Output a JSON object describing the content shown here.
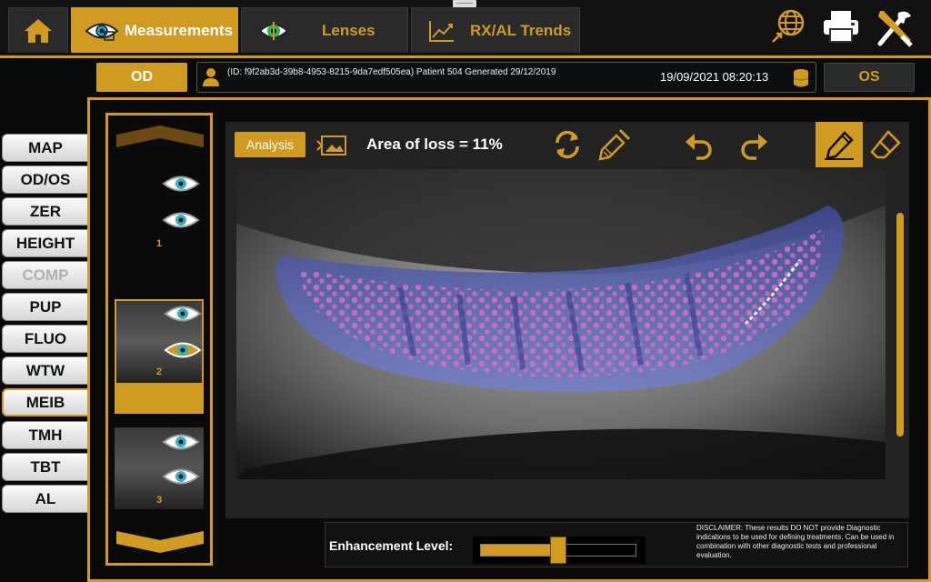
{
  "tabs": [
    {
      "label": ""
    },
    {
      "label": "Measurements",
      "active": true
    },
    {
      "label": "Lenses"
    },
    {
      "label": "RX/AL Trends"
    }
  ],
  "toolbar_icons": [
    "globe-icon",
    "printer-icon",
    "tools-icon"
  ],
  "patient": {
    "od_label": "OD",
    "os_label": "OS",
    "info": "(ID: f9f2ab3d-39b8-4953-8215-9da7edf505ea) Patient 504 Generated 29/12/2019",
    "datetime": "19/09/2021 08:20:13"
  },
  "menu": [
    {
      "label": "MAP"
    },
    {
      "label": "OD/OS"
    },
    {
      "label": "ZER"
    },
    {
      "label": "HEIGHT"
    },
    {
      "label": "COMP",
      "disabled": true
    },
    {
      "label": "PUP"
    },
    {
      "label": "FLUO"
    },
    {
      "label": "WTW"
    },
    {
      "label": "MEIB",
      "active": true
    },
    {
      "label": "TMH"
    },
    {
      "label": "TBT"
    },
    {
      "label": "AL"
    }
  ],
  "thumbnails": [
    {
      "label": "1"
    },
    {
      "label": "2",
      "selected": true
    },
    {
      "label": "3"
    }
  ],
  "analysis": {
    "analysis_label": "Analysis",
    "area_text": "Area of loss = 11%",
    "tools": [
      "image-icon",
      "refresh-icon",
      "brush-icon",
      "undo-icon",
      "redo-icon",
      "pen-icon",
      "eraser-icon"
    ]
  },
  "enhancement": {
    "label": "Enhancement Level:",
    "level": 0.5
  },
  "disclaimer": "DISCLAIMER: These results DO NOT provide Diagnostic indications to be used for defining treatments. Can be used in combination with other diagnostic tests and professional evaluation.",
  "colors": {
    "accent": "#d19b22",
    "overlay": "#4a5bd0",
    "glands": "#d86fc5"
  }
}
